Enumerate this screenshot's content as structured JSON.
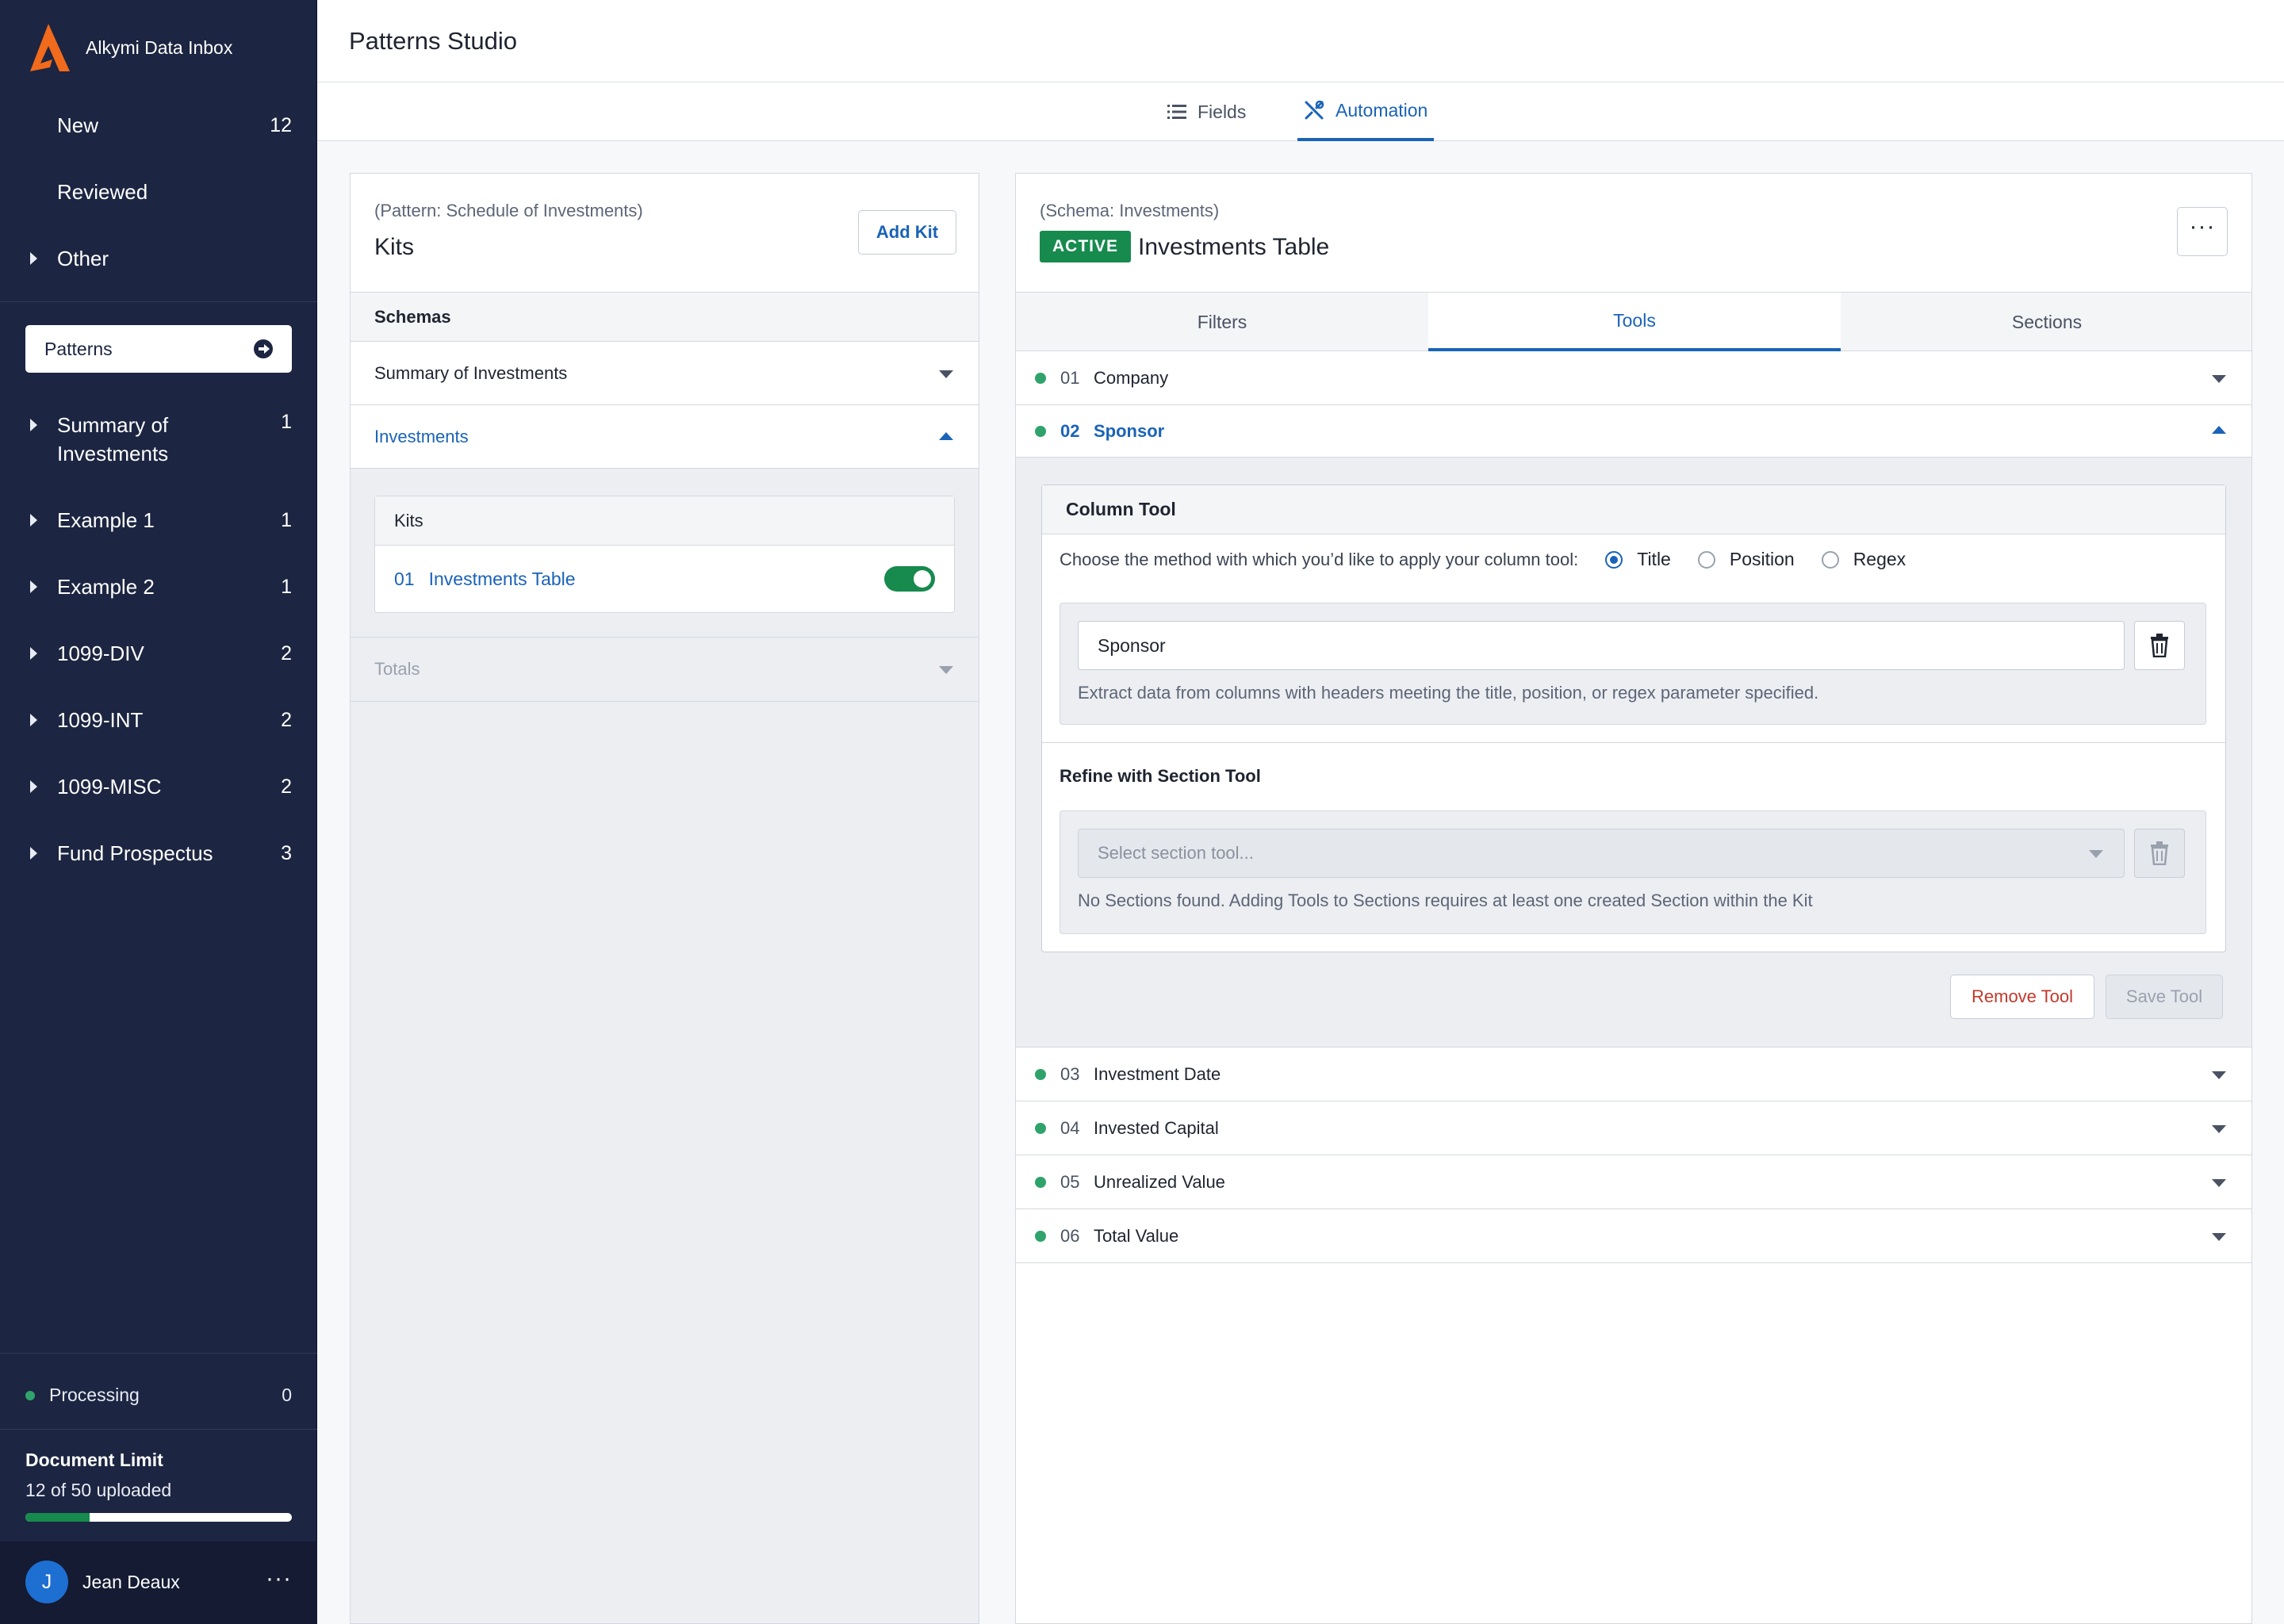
{
  "brand": {
    "name": "Alkymi Data Inbox",
    "logo_color": "#f26a1b"
  },
  "sidebar": {
    "top_items": [
      {
        "label": "New",
        "count": "12"
      },
      {
        "label": "Reviewed",
        "count": ""
      },
      {
        "label": "Other",
        "count": ""
      }
    ],
    "patterns_button": "Patterns",
    "pattern_items": [
      {
        "label": "Summary of Investments",
        "count": "1"
      },
      {
        "label": "Example 1",
        "count": "1"
      },
      {
        "label": "Example 2",
        "count": "1"
      },
      {
        "label": "1099-DIV",
        "count": "2"
      },
      {
        "label": "1099-INT",
        "count": "2"
      },
      {
        "label": "1099-MISC",
        "count": "2"
      },
      {
        "label": "Fund Prospectus",
        "count": "3"
      }
    ],
    "processing": {
      "label": "Processing",
      "count": "0"
    },
    "document_limit": {
      "title": "Document Limit",
      "text": "12 of 50 uploaded",
      "fraction": 0.24
    },
    "user": {
      "initial": "J",
      "name": "Jean Deaux",
      "more": "···"
    }
  },
  "header": {
    "title": "Patterns Studio"
  },
  "main_tabs": [
    {
      "label": "Fields",
      "icon": "list-icon",
      "active": false
    },
    {
      "label": "Automation",
      "icon": "tools-icon",
      "active": true
    }
  ],
  "kits_panel": {
    "pattern_label": "(Pattern: Schedule of Investments)",
    "title": "Kits",
    "add_button": "Add Kit",
    "schemas_header": "Schemas",
    "schemas": [
      {
        "label": "Summary of Investments",
        "expanded": false
      },
      {
        "label": "Investments",
        "expanded": true
      }
    ],
    "kits_box": {
      "header": "Kits",
      "items": [
        {
          "number": "01",
          "name": "Investments Table",
          "enabled": true
        }
      ]
    },
    "totals_label": "Totals"
  },
  "schema_panel": {
    "schema_label": "(Schema: Investments)",
    "status_badge": "ACTIVE",
    "title": "Investments Table",
    "more_button": "···",
    "tabs": [
      {
        "label": "Filters",
        "active": false
      },
      {
        "label": "Tools",
        "active": true
      },
      {
        "label": "Sections",
        "active": false
      }
    ],
    "fields": [
      {
        "number": "01",
        "name": "Company"
      },
      {
        "number": "02",
        "name": "Sponsor"
      },
      {
        "number": "03",
        "name": "Investment Date"
      },
      {
        "number": "04",
        "name": "Invested Capital"
      },
      {
        "number": "05",
        "name": "Unrealized Value"
      },
      {
        "number": "06",
        "name": "Total Value"
      }
    ],
    "column_tool": {
      "header": "Column Tool",
      "method_prompt": "Choose the method with which you’d like to apply your column tool:",
      "methods": [
        {
          "label": "Title",
          "selected": true
        },
        {
          "label": "Position",
          "selected": false
        },
        {
          "label": "Regex",
          "selected": false
        }
      ],
      "value": "Sponsor",
      "help": "Extract data from columns with headers meeting the title, position, or regex parameter specified.",
      "refine_title": "Refine with Section Tool",
      "section_placeholder": "Select section tool...",
      "section_help": "No Sections found. Adding Tools to Sections requires at least one created Section within the Kit"
    },
    "remove_button": "Remove Tool",
    "save_button": "Save Tool"
  },
  "colors": {
    "sidebar": "#1c2541",
    "accent": "#1a63b8",
    "success": "#178a4e",
    "danger": "#c0392b"
  }
}
